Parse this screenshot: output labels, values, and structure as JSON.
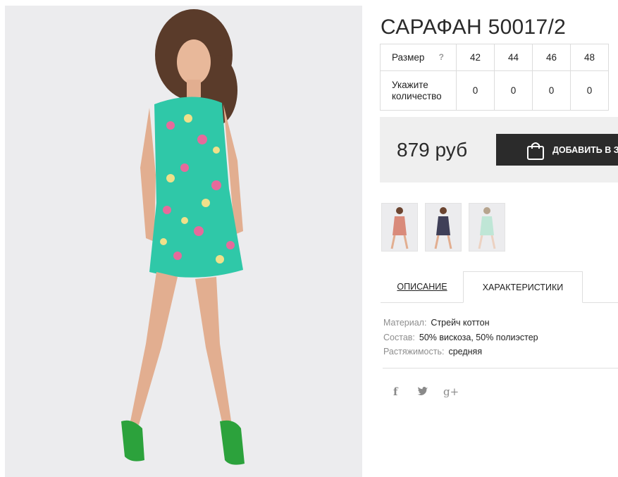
{
  "product": {
    "title": "САРАФАН 50017/2"
  },
  "size_table": {
    "size_label": "Размер",
    "help_icon": "?",
    "sizes": [
      "42",
      "44",
      "46",
      "48"
    ],
    "qty_label_line1": "Укажите",
    "qty_label_line2": "количество",
    "quantities": [
      "0",
      "0",
      "0",
      "0"
    ]
  },
  "purchase": {
    "price": "879 руб",
    "add_to_cart_label": "ДОБАВИТЬ В ЗАКАЗ",
    "button_icon": "shopping-bag-icon"
  },
  "thumbnails": [
    {
      "dress_color": "#d98a7a"
    },
    {
      "dress_color": "#3f3f58"
    },
    {
      "dress_color": "#bfe6d6"
    }
  ],
  "tabs": {
    "description": "ОПИСАНИЕ",
    "characteristics": "ХАРАКТЕРИСТИКИ"
  },
  "characteristics": [
    {
      "key": "Материал:",
      "value": "Стрейч коттон"
    },
    {
      "key": "Состав:",
      "value": "50% вискоза, 50% полиэстер"
    },
    {
      "key": "Растяжимость:",
      "value": "средняя"
    }
  ],
  "social": {
    "facebook": "f",
    "twitter": "twitter-icon",
    "googleplus": "g+"
  },
  "colors": {
    "dress": "#2fc8a8",
    "button": "#2b2b2b",
    "panel": "#efefef"
  }
}
